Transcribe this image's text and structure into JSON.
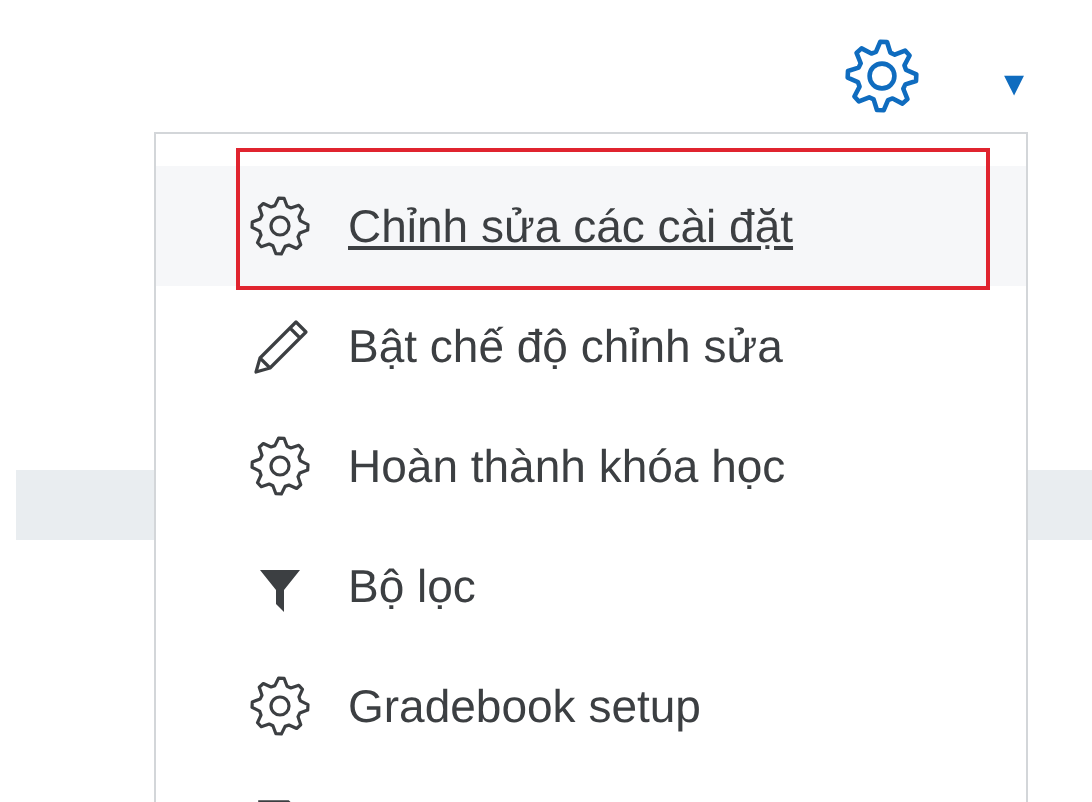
{
  "toolbar": {
    "caret": "▾"
  },
  "menu": {
    "items": [
      {
        "kind": "gear",
        "label": "Chỉnh sửa các cài đặt",
        "selected": true,
        "outlined": true
      },
      {
        "kind": "pencil",
        "label": "Bật chế độ chỉnh sửa",
        "selected": false,
        "outlined": false
      },
      {
        "kind": "gear",
        "label": "Hoàn thành khóa học",
        "selected": false,
        "outlined": false
      },
      {
        "kind": "filter",
        "label": "Bộ lọc",
        "selected": false,
        "outlined": false
      },
      {
        "kind": "gear",
        "label": "Gradebook setup",
        "selected": false,
        "outlined": false
      },
      {
        "kind": "file"
      }
    ]
  }
}
